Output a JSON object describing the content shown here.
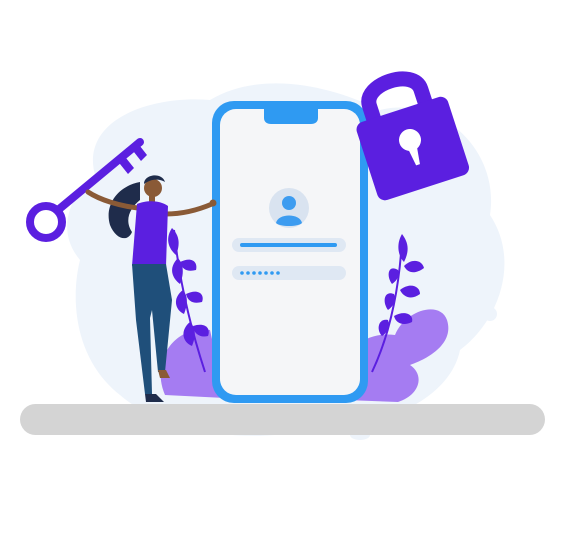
{
  "illustration": {
    "scene": "mobile-login-security",
    "icons": [
      "key-icon",
      "padlock-icon",
      "user-avatar-icon"
    ],
    "colors": {
      "accent_purple": "#5b1fe0",
      "light_purple": "#a57cf2",
      "phone_blue": "#2f9af2",
      "screen_bg": "#f5f6f8",
      "field_bg": "#dfe8f3",
      "avatar_bg": "#d9e3f0",
      "avatar_fg": "#3d9cf0",
      "blob_bg": "#eef4fb",
      "ground": "#d4d4d4",
      "skin": "#8a5a36",
      "hair": "#1f2c4b",
      "pants": "#1f4f7a"
    },
    "login_form": {
      "username_field_filled": true,
      "password_masked": "•••••••"
    }
  }
}
